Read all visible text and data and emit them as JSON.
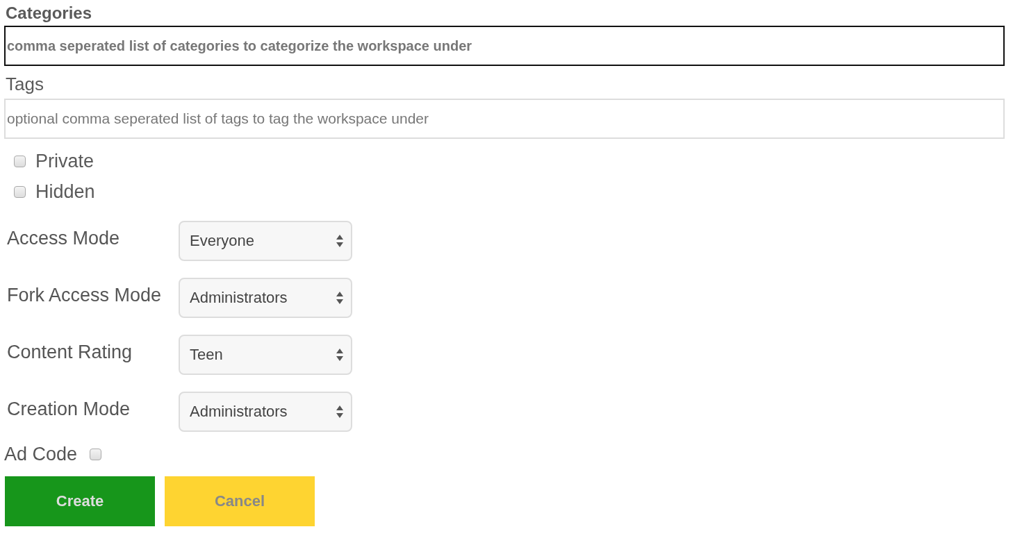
{
  "categories": {
    "label": "Categories",
    "placeholder": "comma seperated list of categories to categorize the workspace under",
    "focused": true
  },
  "tags": {
    "label": "Tags",
    "placeholder": "optional comma seperated list of tags to tag the workspace under",
    "focused": false
  },
  "flags": [
    {
      "label": "Private",
      "checked": false
    },
    {
      "label": "Hidden",
      "checked": false
    }
  ],
  "selects": [
    {
      "label": "Access Mode",
      "value": "Everyone"
    },
    {
      "label": "Fork Access Mode",
      "value": "Administrators"
    },
    {
      "label": "Content Rating",
      "value": "Teen"
    },
    {
      "label": "Creation Mode",
      "value": "Administrators"
    }
  ],
  "ad_code": {
    "label": "Ad Code",
    "checked": false
  },
  "buttons": [
    {
      "label": "Create",
      "kind": "primary"
    },
    {
      "label": "Cancel",
      "kind": "secondary"
    }
  ]
}
